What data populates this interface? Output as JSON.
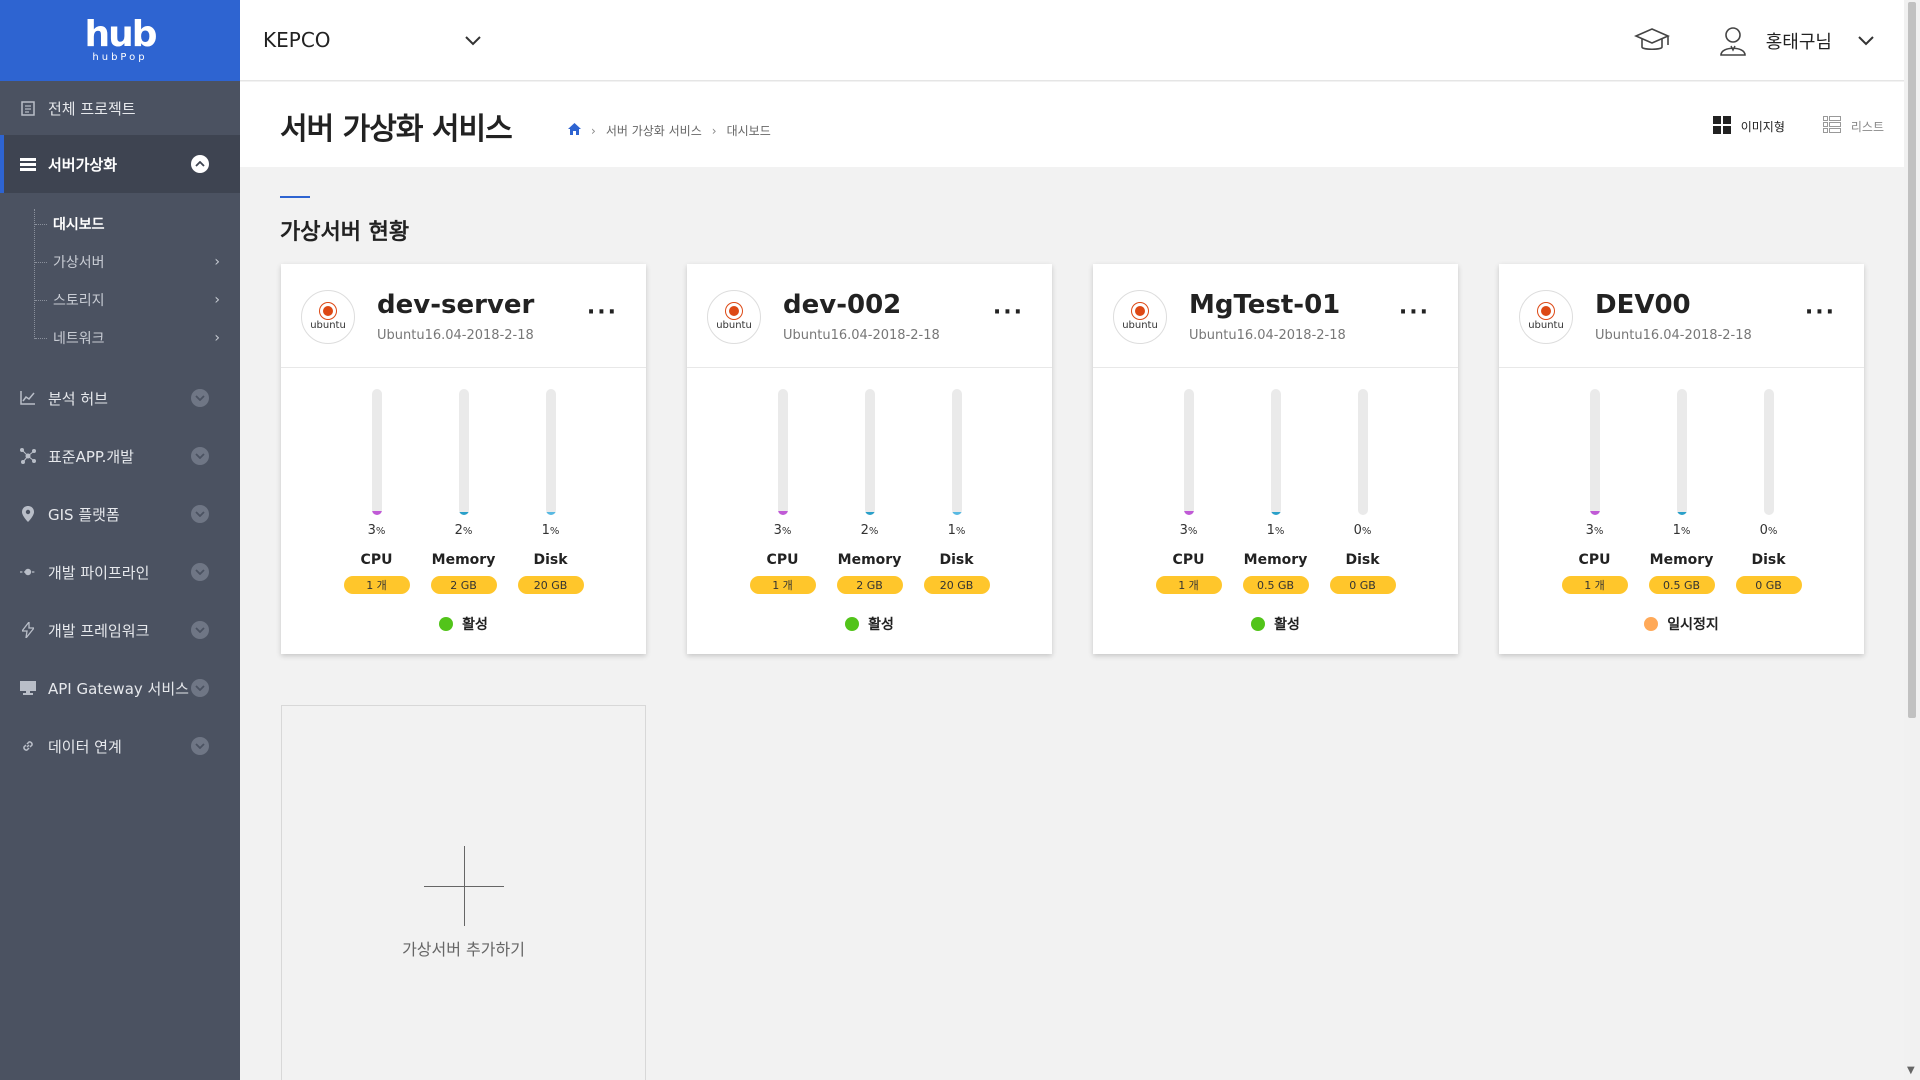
{
  "logo": {
    "main": "hub",
    "sub": "hubPop"
  },
  "sidebar": {
    "items": [
      {
        "label": "전체 프로젝트"
      },
      {
        "label": "서버가상화"
      },
      {
        "label": "분석 허브"
      },
      {
        "label": "표준APP.개발"
      },
      {
        "label": "GIS 플랫폼"
      },
      {
        "label": "개발 파이프라인"
      },
      {
        "label": "개발 프레임워크"
      },
      {
        "label": "API Gateway 서비스"
      },
      {
        "label": "데이터 연계"
      }
    ],
    "submenu": [
      {
        "label": "대시보드"
      },
      {
        "label": "가상서버"
      },
      {
        "label": "스토리지"
      },
      {
        "label": "네트워크"
      }
    ]
  },
  "header": {
    "company": "KEPCO",
    "username": "홍태구님"
  },
  "page": {
    "title": "서버 가상화 서비스",
    "breadcrumb": [
      "서버 가상화 서비스",
      "대시보드"
    ],
    "view_image": "이미지형",
    "view_list": "리스트",
    "section_title": "가상서버 현황",
    "add_label": "가상서버 추가하기"
  },
  "colors": {
    "cpu": "#c05ad6",
    "memory": "#2aa0c9",
    "disk": "#58b9e2",
    "active": "#52c41a",
    "paused": "#ffa958",
    "badge": "#ffc62b"
  },
  "servers": [
    {
      "name": "dev-server",
      "os": "ubuntu",
      "image": "Ubuntu16.04-2018-2-18",
      "metrics": [
        {
          "label": "CPU",
          "value": "3",
          "unit": "%",
          "badge": "1 개"
        },
        {
          "label": "Memory",
          "value": "2",
          "unit": "%",
          "badge": "2 GB"
        },
        {
          "label": "Disk",
          "value": "1",
          "unit": "%",
          "badge": "20 GB"
        }
      ],
      "status": "활성",
      "status_kind": "active"
    },
    {
      "name": "dev-002",
      "os": "ubuntu",
      "image": "Ubuntu16.04-2018-2-18",
      "metrics": [
        {
          "label": "CPU",
          "value": "3",
          "unit": "%",
          "badge": "1 개"
        },
        {
          "label": "Memory",
          "value": "2",
          "unit": "%",
          "badge": "2 GB"
        },
        {
          "label": "Disk",
          "value": "1",
          "unit": "%",
          "badge": "20 GB"
        }
      ],
      "status": "활성",
      "status_kind": "active"
    },
    {
      "name": "MgTest-01",
      "os": "ubuntu",
      "image": "Ubuntu16.04-2018-2-18",
      "metrics": [
        {
          "label": "CPU",
          "value": "3",
          "unit": "%",
          "badge": "1 개"
        },
        {
          "label": "Memory",
          "value": "1",
          "unit": "%",
          "badge": "0.5 GB"
        },
        {
          "label": "Disk",
          "value": "0",
          "unit": "%",
          "badge": "0 GB"
        }
      ],
      "status": "활성",
      "status_kind": "active"
    },
    {
      "name": "DEV00",
      "os": "ubuntu",
      "image": "Ubuntu16.04-2018-2-18",
      "metrics": [
        {
          "label": "CPU",
          "value": "3",
          "unit": "%",
          "badge": "1 개"
        },
        {
          "label": "Memory",
          "value": "1",
          "unit": "%",
          "badge": "0.5 GB"
        },
        {
          "label": "Disk",
          "value": "0",
          "unit": "%",
          "badge": "0 GB"
        }
      ],
      "status": "일시정지",
      "status_kind": "paused"
    }
  ]
}
